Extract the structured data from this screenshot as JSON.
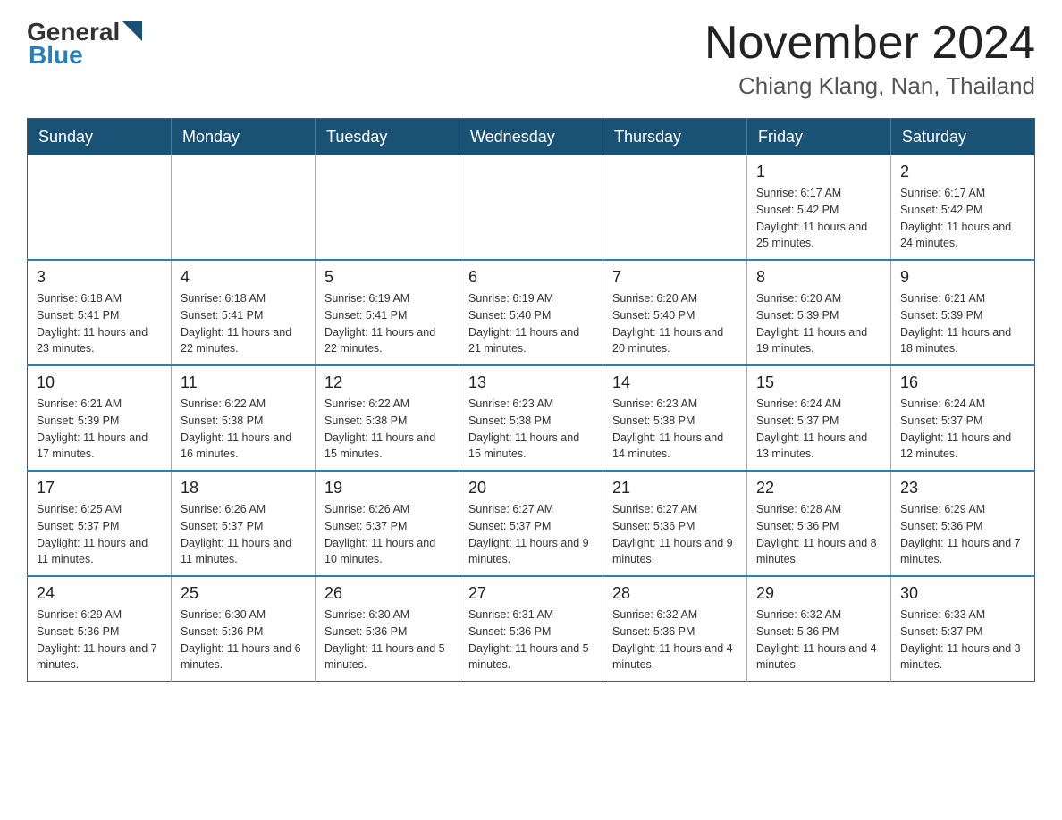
{
  "header": {
    "logo": {
      "general": "General",
      "blue": "Blue"
    },
    "title": "November 2024",
    "location": "Chiang Klang, Nan, Thailand"
  },
  "days_of_week": [
    "Sunday",
    "Monday",
    "Tuesday",
    "Wednesday",
    "Thursday",
    "Friday",
    "Saturday"
  ],
  "weeks": [
    [
      {
        "day": "",
        "info": ""
      },
      {
        "day": "",
        "info": ""
      },
      {
        "day": "",
        "info": ""
      },
      {
        "day": "",
        "info": ""
      },
      {
        "day": "",
        "info": ""
      },
      {
        "day": "1",
        "info": "Sunrise: 6:17 AM\nSunset: 5:42 PM\nDaylight: 11 hours and 25 minutes."
      },
      {
        "day": "2",
        "info": "Sunrise: 6:17 AM\nSunset: 5:42 PM\nDaylight: 11 hours and 24 minutes."
      }
    ],
    [
      {
        "day": "3",
        "info": "Sunrise: 6:18 AM\nSunset: 5:41 PM\nDaylight: 11 hours and 23 minutes."
      },
      {
        "day": "4",
        "info": "Sunrise: 6:18 AM\nSunset: 5:41 PM\nDaylight: 11 hours and 22 minutes."
      },
      {
        "day": "5",
        "info": "Sunrise: 6:19 AM\nSunset: 5:41 PM\nDaylight: 11 hours and 22 minutes."
      },
      {
        "day": "6",
        "info": "Sunrise: 6:19 AM\nSunset: 5:40 PM\nDaylight: 11 hours and 21 minutes."
      },
      {
        "day": "7",
        "info": "Sunrise: 6:20 AM\nSunset: 5:40 PM\nDaylight: 11 hours and 20 minutes."
      },
      {
        "day": "8",
        "info": "Sunrise: 6:20 AM\nSunset: 5:39 PM\nDaylight: 11 hours and 19 minutes."
      },
      {
        "day": "9",
        "info": "Sunrise: 6:21 AM\nSunset: 5:39 PM\nDaylight: 11 hours and 18 minutes."
      }
    ],
    [
      {
        "day": "10",
        "info": "Sunrise: 6:21 AM\nSunset: 5:39 PM\nDaylight: 11 hours and 17 minutes."
      },
      {
        "day": "11",
        "info": "Sunrise: 6:22 AM\nSunset: 5:38 PM\nDaylight: 11 hours and 16 minutes."
      },
      {
        "day": "12",
        "info": "Sunrise: 6:22 AM\nSunset: 5:38 PM\nDaylight: 11 hours and 15 minutes."
      },
      {
        "day": "13",
        "info": "Sunrise: 6:23 AM\nSunset: 5:38 PM\nDaylight: 11 hours and 15 minutes."
      },
      {
        "day": "14",
        "info": "Sunrise: 6:23 AM\nSunset: 5:38 PM\nDaylight: 11 hours and 14 minutes."
      },
      {
        "day": "15",
        "info": "Sunrise: 6:24 AM\nSunset: 5:37 PM\nDaylight: 11 hours and 13 minutes."
      },
      {
        "day": "16",
        "info": "Sunrise: 6:24 AM\nSunset: 5:37 PM\nDaylight: 11 hours and 12 minutes."
      }
    ],
    [
      {
        "day": "17",
        "info": "Sunrise: 6:25 AM\nSunset: 5:37 PM\nDaylight: 11 hours and 11 minutes."
      },
      {
        "day": "18",
        "info": "Sunrise: 6:26 AM\nSunset: 5:37 PM\nDaylight: 11 hours and 11 minutes."
      },
      {
        "day": "19",
        "info": "Sunrise: 6:26 AM\nSunset: 5:37 PM\nDaylight: 11 hours and 10 minutes."
      },
      {
        "day": "20",
        "info": "Sunrise: 6:27 AM\nSunset: 5:37 PM\nDaylight: 11 hours and 9 minutes."
      },
      {
        "day": "21",
        "info": "Sunrise: 6:27 AM\nSunset: 5:36 PM\nDaylight: 11 hours and 9 minutes."
      },
      {
        "day": "22",
        "info": "Sunrise: 6:28 AM\nSunset: 5:36 PM\nDaylight: 11 hours and 8 minutes."
      },
      {
        "day": "23",
        "info": "Sunrise: 6:29 AM\nSunset: 5:36 PM\nDaylight: 11 hours and 7 minutes."
      }
    ],
    [
      {
        "day": "24",
        "info": "Sunrise: 6:29 AM\nSunset: 5:36 PM\nDaylight: 11 hours and 7 minutes."
      },
      {
        "day": "25",
        "info": "Sunrise: 6:30 AM\nSunset: 5:36 PM\nDaylight: 11 hours and 6 minutes."
      },
      {
        "day": "26",
        "info": "Sunrise: 6:30 AM\nSunset: 5:36 PM\nDaylight: 11 hours and 5 minutes."
      },
      {
        "day": "27",
        "info": "Sunrise: 6:31 AM\nSunset: 5:36 PM\nDaylight: 11 hours and 5 minutes."
      },
      {
        "day": "28",
        "info": "Sunrise: 6:32 AM\nSunset: 5:36 PM\nDaylight: 11 hours and 4 minutes."
      },
      {
        "day": "29",
        "info": "Sunrise: 6:32 AM\nSunset: 5:36 PM\nDaylight: 11 hours and 4 minutes."
      },
      {
        "day": "30",
        "info": "Sunrise: 6:33 AM\nSunset: 5:37 PM\nDaylight: 11 hours and 3 minutes."
      }
    ]
  ]
}
